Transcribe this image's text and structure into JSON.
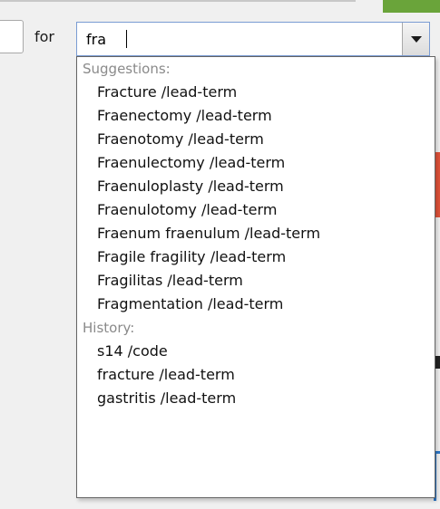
{
  "search": {
    "for_label": "for",
    "query": "fra"
  },
  "dropdown": {
    "suggestions_header": "Suggestions:",
    "suggestions": [
      "Fracture /lead-term",
      "Fraenectomy /lead-term",
      "Fraenotomy /lead-term",
      "Fraenulectomy /lead-term",
      "Fraenuloplasty /lead-term",
      "Fraenulotomy /lead-term",
      "Fraenum fraenulum /lead-term",
      "Fragile fragility /lead-term",
      "Fragilitas /lead-term",
      "Fragmentation /lead-term"
    ],
    "history_header": "History:",
    "history": [
      "s14 /code",
      "fracture /lead-term",
      "gastritis /lead-term"
    ]
  },
  "icons": {
    "combo_button": "chevron-down-icon"
  },
  "colors": {
    "focus_border": "#7a9cd3",
    "section_header_text": "#8a8a8a",
    "background": "#f0f0f0"
  }
}
